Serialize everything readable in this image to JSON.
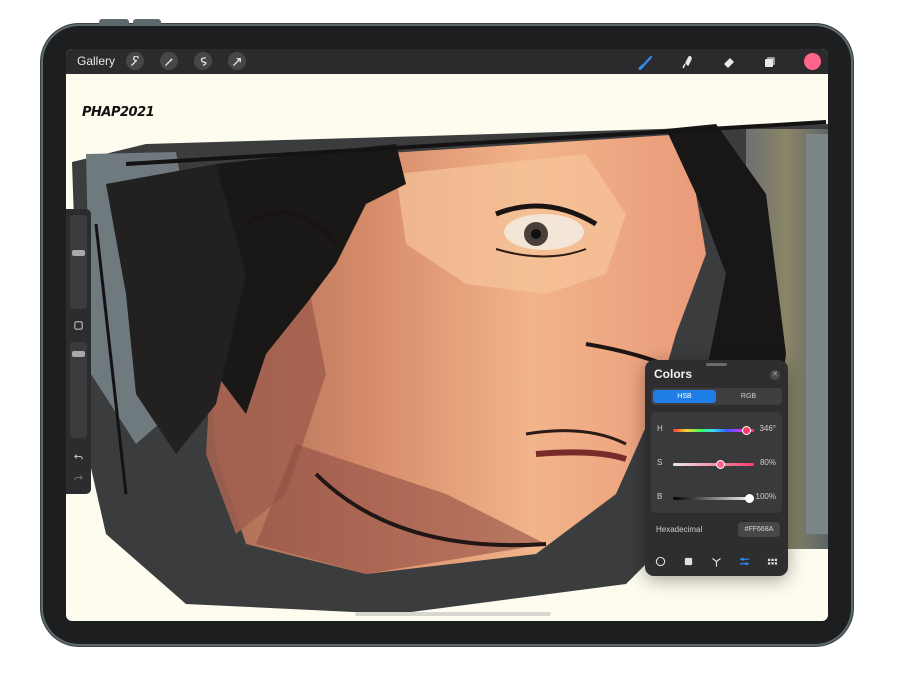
{
  "topbar": {
    "gallery_label": "Gallery",
    "left_tools": [
      "wrench-icon",
      "magic-wand-icon",
      "selection-icon",
      "transform-arrow-icon"
    ],
    "right_tools": [
      "brush-icon",
      "smudge-icon",
      "eraser-icon",
      "layers-icon"
    ],
    "active_color": "#FF668A",
    "active_tool_color": "#2f8ef2"
  },
  "canvas": {
    "signature": "PHAP2021"
  },
  "sidebar": {
    "brush_size_level": 0.6,
    "opacity_level": 0.9,
    "buttons": [
      "modify-square-icon",
      "undo-icon",
      "redo-icon"
    ]
  },
  "colors_panel": {
    "title": "Colors",
    "tabs": [
      {
        "label": "HSB",
        "active": true
      },
      {
        "label": "RGB",
        "active": false
      }
    ],
    "sliders": [
      {
        "label": "H",
        "value": "346°",
        "level": 0.96
      },
      {
        "label": "S",
        "value": "80%",
        "level": 0.6
      },
      {
        "label": "B",
        "value": "100%",
        "level": 1.0
      }
    ],
    "hex_label": "Hexadecimal",
    "hex_value": "#FF668A",
    "bottom_tabs": [
      "disc-icon",
      "classic-square-icon",
      "harmony-icon",
      "value-sliders-icon",
      "palettes-grid-icon"
    ],
    "active_bottom_tab": 3
  }
}
